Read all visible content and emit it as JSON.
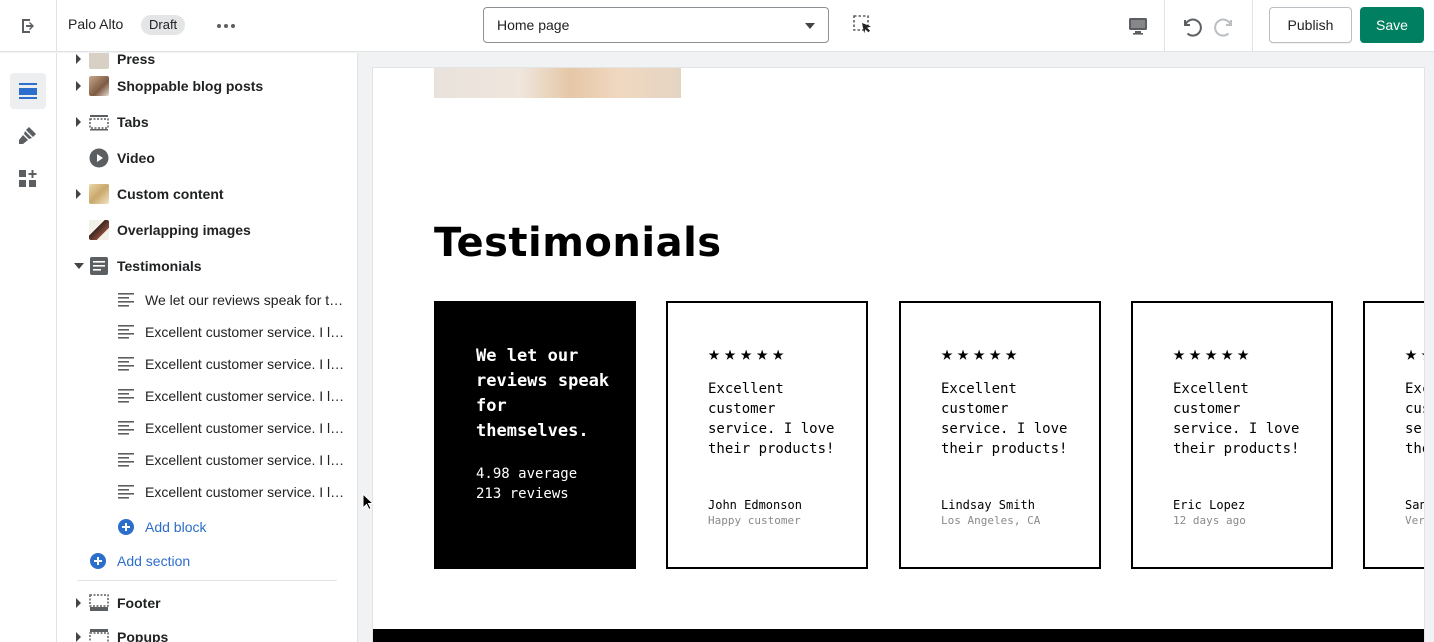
{
  "topbar": {
    "store_name": "Palo Alto",
    "status_badge": "Draft",
    "page_selector": "Home page",
    "publish_label": "Publish",
    "save_label": "Save"
  },
  "rail": {
    "items": [
      "sections-icon",
      "theme-settings-icon",
      "apps-icon"
    ]
  },
  "sidebar": {
    "partial_top_label": "Press",
    "sections": [
      {
        "label": "Shoppable blog posts",
        "icon": "image-thumb",
        "collapsible": true
      },
      {
        "label": "Tabs",
        "icon": "tabs-icon",
        "collapsible": true
      },
      {
        "label": "Video",
        "icon": "play-icon",
        "collapsible": false
      },
      {
        "label": "Custom content",
        "icon": "image-thumb",
        "collapsible": true
      },
      {
        "label": "Overlapping images",
        "icon": "image-thumb",
        "collapsible": false
      },
      {
        "label": "Testimonials",
        "icon": "text-block-icon",
        "collapsible": true,
        "expanded": true
      }
    ],
    "blocks": [
      "We let our reviews speak for themselves.",
      "Excellent customer service. I love their products!",
      "Excellent customer service. I love their products!",
      "Excellent customer service. I love their products!",
      "Excellent customer service. I love their products!",
      "Excellent customer service. I love their products!",
      "Excellent customer service. I love their products!"
    ],
    "add_block": "Add block",
    "add_section": "Add section",
    "footer_sections": [
      {
        "label": "Footer"
      },
      {
        "label": "Popups"
      }
    ]
  },
  "preview": {
    "heading": "Testimonials",
    "intro_card": {
      "headline": "We let our reviews speak for themselves.",
      "average": "4.98 average",
      "reviews": "213 reviews"
    },
    "stars": "★★★★★",
    "cards": [
      {
        "quote": "Excellent customer service. I love their products!",
        "author": "John Edmonson",
        "meta": "Happy customer"
      },
      {
        "quote": "Excellent customer service. I love their products!",
        "author": "Lindsay Smith",
        "meta": "Los Angeles, CA"
      },
      {
        "quote": "Excellent customer service. I love their products!",
        "author": "Eric Lopez",
        "meta": "12 days ago"
      },
      {
        "quote": "Excellent customer service. I love their products!",
        "author": "Sandra",
        "meta": "Verified"
      }
    ]
  },
  "colors": {
    "primary_green": "#008060",
    "link_blue": "#2c6ecb"
  }
}
